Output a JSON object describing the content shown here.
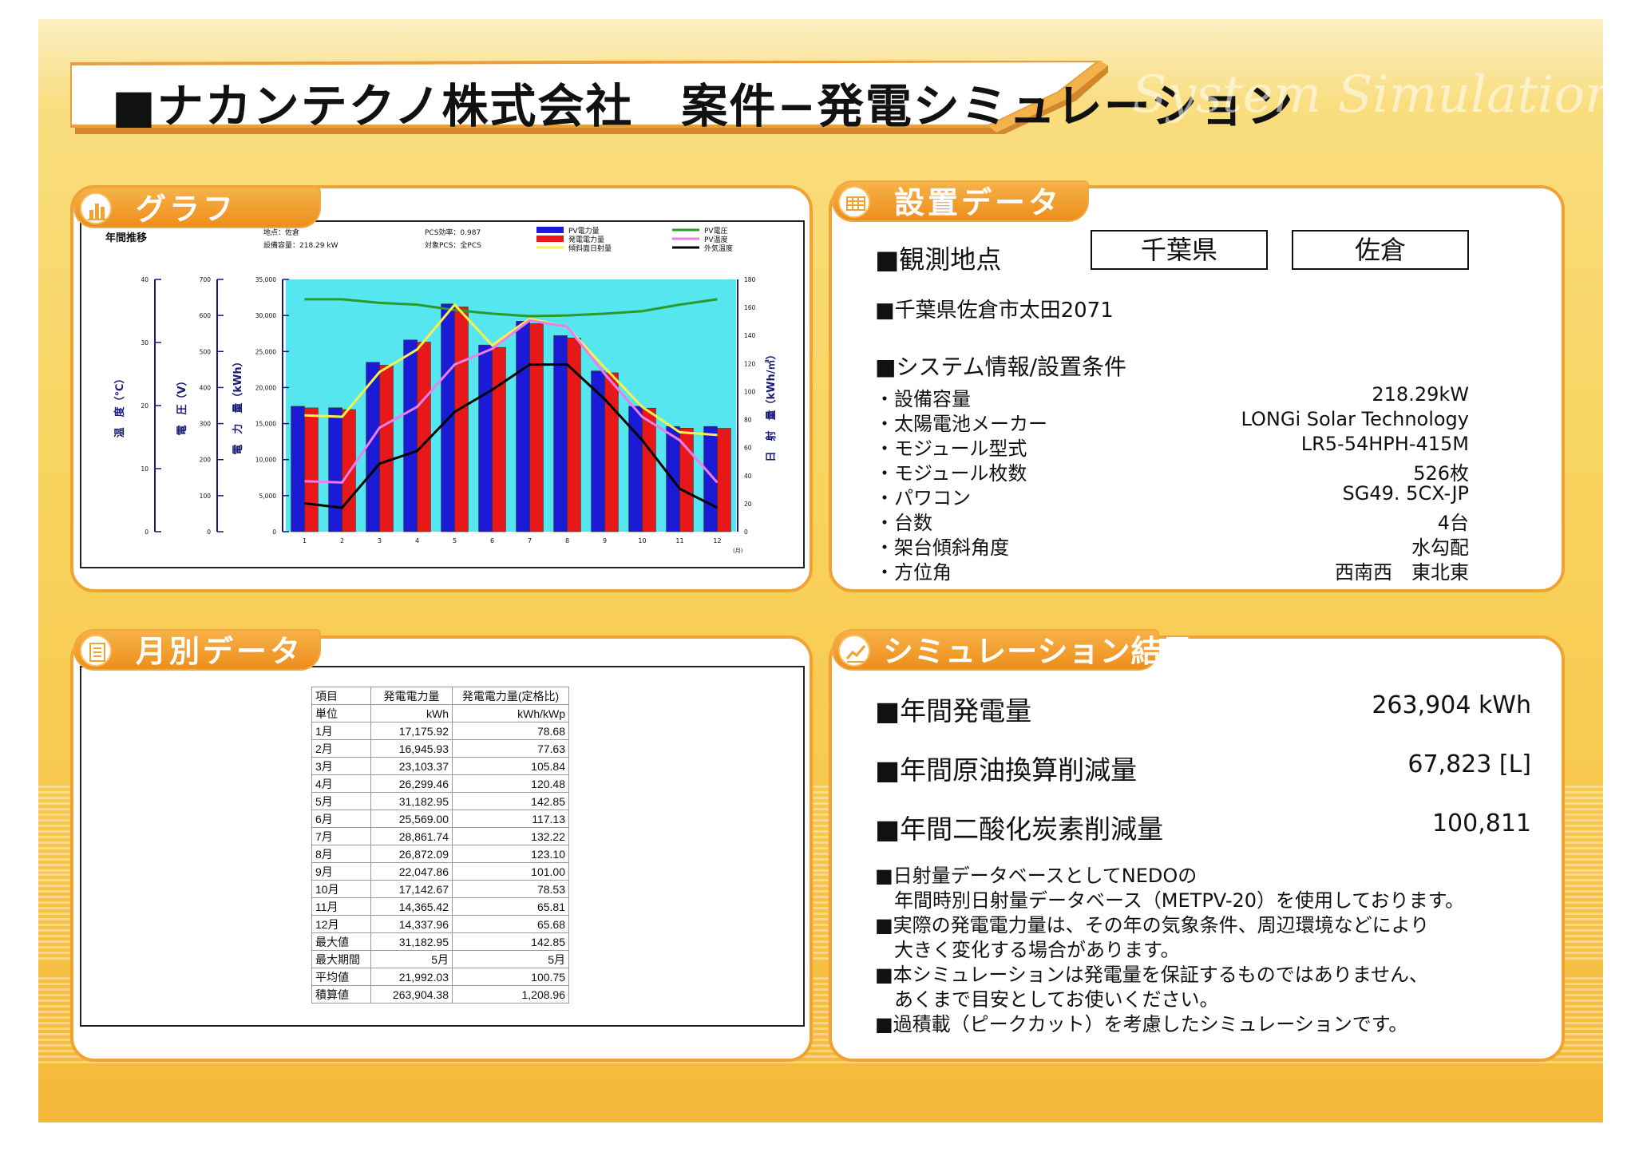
{
  "title": {
    "main": "■ナカンテクノ株式会社　案件−発電シミュレーション",
    "watermark": "System Simulation"
  },
  "colors": {
    "accent_orange": "#f0a232",
    "plot_bg": "#55e6f0",
    "bar_pv_blue": "#1b1bd6",
    "bar_gen_red": "#e81818",
    "line_pv_voltage": "#2a9a2a",
    "line_pv_temp": "#ef7cef",
    "line_irradiance": "#f7f24a",
    "line_air_temp": "#000000",
    "axis_navy": "#1a1a7a"
  },
  "graph_panel": {
    "tab_label": "グラフ",
    "tab_icon": "bar-chart-icon"
  },
  "chart_data": {
    "type": "bar",
    "title": "年間推移",
    "info": {
      "location": "地点：佐倉",
      "capacity": "設備容量：218.29 kW",
      "pcs_eff": "PCS効率：0.987",
      "pcs_target": "対象PCS：全PCS"
    },
    "legend": [
      "PV電力量",
      "発電電力量",
      "傾斜面日射量",
      "PV電圧",
      "PV温度",
      "外気温度"
    ],
    "categories": [
      "1",
      "2",
      "3",
      "4",
      "5",
      "6",
      "7",
      "8",
      "9",
      "10",
      "11",
      "12"
    ],
    "x_unit": "(月)",
    "axes": {
      "temp": {
        "label": "温　度（℃）",
        "ticks": [
          "0",
          "10",
          "20",
          "30",
          "40"
        ],
        "range": [
          0,
          40
        ]
      },
      "voltage": {
        "label": "電　圧（V）",
        "ticks": [
          "0",
          "100",
          "200",
          "300",
          "400",
          "500",
          "600",
          "700"
        ],
        "range": [
          0,
          700
        ]
      },
      "energy": {
        "label": "電　力　量（kWh）",
        "ticks": [
          "0",
          "5,000",
          "10,000",
          "15,000",
          "20,000",
          "25,000",
          "30,000",
          "35,000"
        ],
        "range": [
          0,
          35000
        ]
      },
      "irradiance": {
        "label": "日　射　量（kWh/㎡）",
        "ticks": [
          "0",
          "20",
          "40",
          "60",
          "80",
          "100",
          "120",
          "140",
          "160",
          "180"
        ],
        "range": [
          0,
          180
        ]
      }
    },
    "series": [
      {
        "name": "PV電力量",
        "axis": "energy",
        "values": [
          17400,
          17200,
          23500,
          26600,
          31600,
          25900,
          29200,
          27200,
          22300,
          17400,
          14600,
          14600
        ]
      },
      {
        "name": "発電電力量",
        "axis": "energy",
        "values": [
          17175.92,
          16945.93,
          23103.37,
          26299.46,
          31182.95,
          25569.0,
          28861.74,
          26872.09,
          22047.86,
          17142.67,
          14365.42,
          14337.96
        ]
      },
      {
        "name": "傾斜面日射量",
        "axis": "irradiance",
        "values": [
          83,
          82,
          114,
          130,
          162,
          133,
          152,
          146,
          117,
          89,
          71,
          69
        ]
      },
      {
        "name": "PV電圧",
        "axis": "voltage",
        "values": [
          645,
          645,
          635,
          630,
          615,
          605,
          598,
          600,
          605,
          612,
          630,
          645
        ]
      },
      {
        "name": "PV温度",
        "axis": "temp",
        "values": [
          8.0,
          7.8,
          16.5,
          19.8,
          26.5,
          29.0,
          33.5,
          32.5,
          25.0,
          18.2,
          14.5,
          7.8
        ]
      },
      {
        "name": "外気温度",
        "axis": "temp",
        "values": [
          4.5,
          3.8,
          10.8,
          12.8,
          19.0,
          22.5,
          26.5,
          26.5,
          21.0,
          14.5,
          6.8,
          3.8
        ]
      }
    ]
  },
  "install_panel": {
    "tab_label": "設置データ",
    "tab_icon": "grid-table-icon",
    "obs_label": "■観測地点",
    "prefecture": "千葉県",
    "city": "佐倉",
    "address": "■千葉県佐倉市太田2071",
    "sys_heading": "■システム情報/設置条件",
    "rows": [
      {
        "label": "・設備容量",
        "value": "218.29kW"
      },
      {
        "label": "・太陽電池メーカー",
        "value": "LONGi Solar Technology"
      },
      {
        "label": "・モジュール型式",
        "value": "LR5-54HPH-415M"
      },
      {
        "label": "・モジュール枚数",
        "value": "526枚"
      },
      {
        "label": "・パワコン",
        "value": "SG49. 5CX-JP"
      },
      {
        "label": "・台数",
        "value": "4台"
      },
      {
        "label": "・架台傾斜角度",
        "value": "水勾配"
      },
      {
        "label": "・方位角",
        "value": "西南西　東北東"
      }
    ]
  },
  "monthly_panel": {
    "tab_label": "月別データ",
    "tab_icon": "list-icon",
    "header": [
      "項目",
      "発電電力量",
      "発電電力量(定格比)"
    ],
    "units": [
      "単位",
      "kWh",
      "kWh/kWp"
    ],
    "rows": [
      [
        "1月",
        "17,175.92",
        "78.68"
      ],
      [
        "2月",
        "16,945.93",
        "77.63"
      ],
      [
        "3月",
        "23,103.37",
        "105.84"
      ],
      [
        "4月",
        "26,299.46",
        "120.48"
      ],
      [
        "5月",
        "31,182.95",
        "142.85"
      ],
      [
        "6月",
        "25,569.00",
        "117.13"
      ],
      [
        "7月",
        "28,861.74",
        "132.22"
      ],
      [
        "8月",
        "26,872.09",
        "123.10"
      ],
      [
        "9月",
        "22,047.86",
        "101.00"
      ],
      [
        "10月",
        "17,142.67",
        "78.53"
      ],
      [
        "11月",
        "14,365.42",
        "65.81"
      ],
      [
        "12月",
        "14,337.96",
        "65.68"
      ],
      [
        "最大値",
        "31,182.95",
        "142.85"
      ],
      [
        "最大期間",
        "5月",
        "5月"
      ],
      [
        "平均値",
        "21,992.03",
        "100.75"
      ],
      [
        "積算値",
        "263,904.38",
        "1,208.96"
      ]
    ]
  },
  "result_panel": {
    "tab_label": "シミュレーション結果",
    "tab_icon": "trend-line-icon",
    "items": [
      {
        "label": "■年間発電量",
        "value": "263,904 kWh"
      },
      {
        "label": "■年間原油換算削減量",
        "value": "67,823 [L]"
      },
      {
        "label": "■年間二酸化炭素削減量",
        "value": "100,811"
      }
    ],
    "notes": [
      "■日射量データベースとしてNEDOの",
      "　年間時別日射量データベース（METPV-20）を使用しております。",
      "■実際の発電電力量は、その年の気象条件、周辺環境などにより",
      "　大きく変化する場合があります。",
      "■本シミュレーションは発電量を保証するものではありません、",
      "　あくまで目安としてお使いください。",
      "■過積載（ピークカット）を考慮したシミュレーションです。"
    ]
  }
}
